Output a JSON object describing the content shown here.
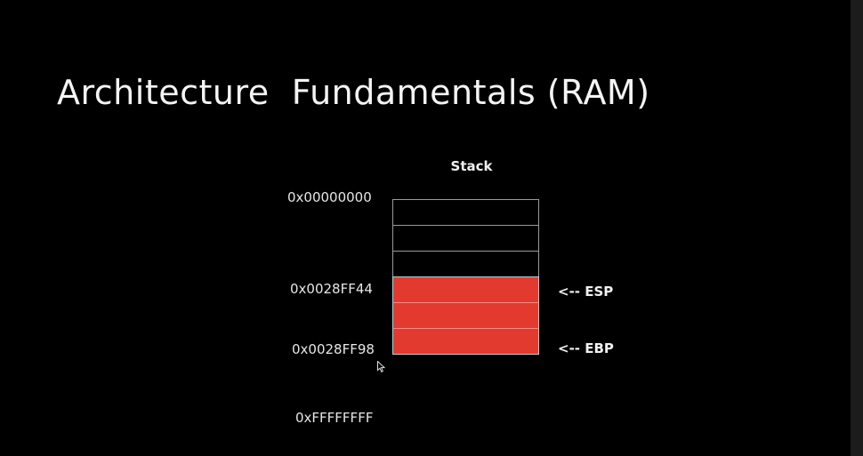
{
  "slide": {
    "title": "Architecture  Fundamentals (RAM)"
  },
  "diagram": {
    "stack_label": "Stack",
    "addresses": {
      "top": "0x00000000",
      "esp_addr": "0x0028FF44",
      "ebp_addr": "0x0028FF98",
      "bottom": "0xFFFFFFFF"
    },
    "pointers": {
      "esp": "<-- ESP",
      "ebp": "<-- EBP"
    },
    "slots": [
      {
        "state": "empty"
      },
      {
        "state": "empty"
      },
      {
        "state": "empty"
      },
      {
        "state": "used"
      },
      {
        "state": "used"
      },
      {
        "state": "used"
      }
    ],
    "colors": {
      "used_slot": "#e33a30",
      "empty_slot": "#000000",
      "slot_border": "#9a9a9a"
    }
  },
  "cursor_icon": "mouse-pointer-icon"
}
